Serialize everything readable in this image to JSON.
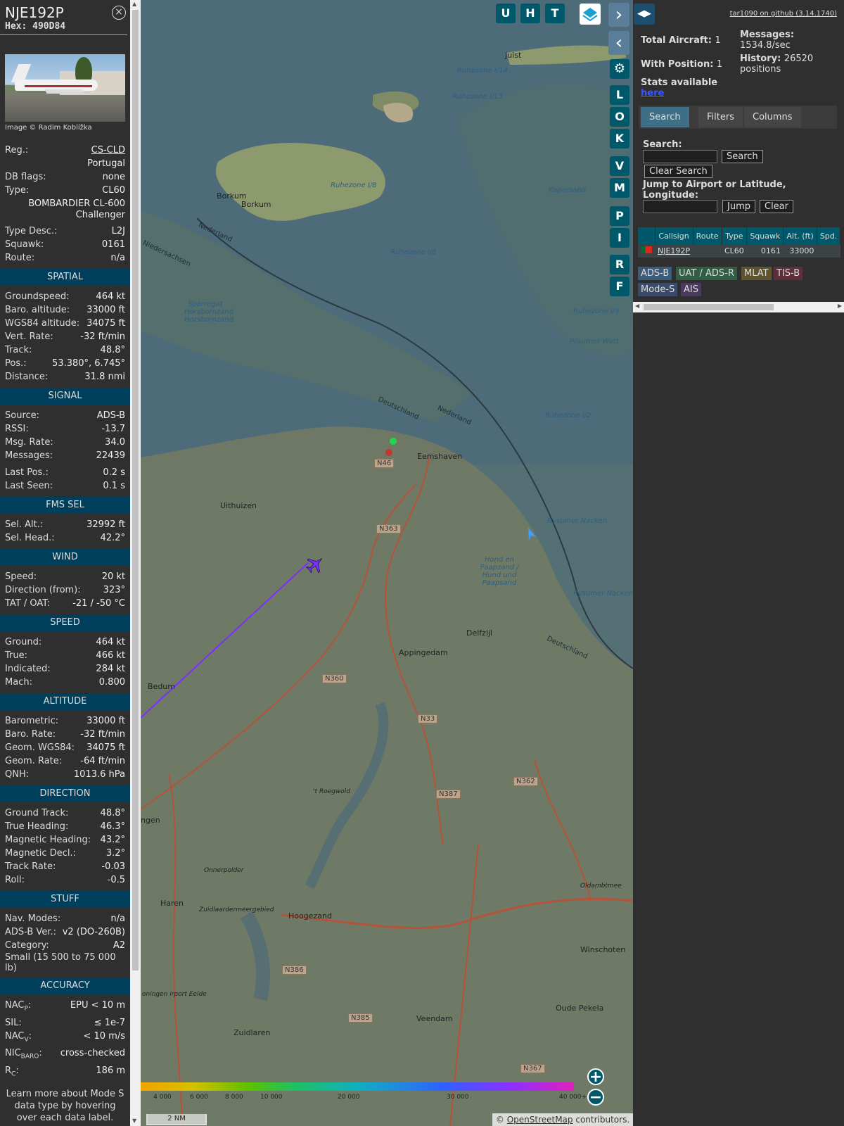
{
  "aircraft": {
    "callsign": "NJE192P",
    "hex": "Hex: 490D84",
    "photo_credit": "Image © Radim Koblížka",
    "close_icon": "×",
    "reg_label": "Reg.:",
    "reg_value": "CS-CLD",
    "country": "Portugal",
    "dbflags_label": "DB flags:",
    "dbflags_value": "none",
    "type_label": "Type:",
    "type_value": "CL60",
    "type_full": "BOMBARDIER CL-600 Challenger",
    "typedesc_label": "Type Desc.:",
    "typedesc_value": "L2J",
    "squawk_label": "Squawk:",
    "squawk_value": "0161",
    "route_label": "Route:",
    "route_value": "n/a"
  },
  "sections": [
    {
      "title": "SPATIAL",
      "rows": [
        {
          "label": "Groundspeed:",
          "value": "464 kt"
        },
        {
          "label": "Baro. altitude:",
          "value": "33000 ft"
        },
        {
          "label": "WGS84 altitude:",
          "value": "34075 ft"
        },
        {
          "label": "Vert. Rate:",
          "value": "-32 ft/min"
        },
        {
          "label": "Track:",
          "value": "48.8°"
        },
        {
          "label": "Pos.:",
          "value": "53.380°, 6.745°"
        },
        {
          "label": "Distance:",
          "value": "31.8 nmi"
        }
      ]
    },
    {
      "title": "SIGNAL",
      "rows": [
        {
          "label": "Source:",
          "value": "ADS-B"
        },
        {
          "label": "RSSI:",
          "value": "-13.7"
        },
        {
          "label": "Msg. Rate:",
          "value": "34.0"
        },
        {
          "label": "Messages:",
          "value": "22439"
        },
        {
          "label": "Last Pos.:",
          "value": "0.2 s"
        },
        {
          "label": "Last Seen:",
          "value": "0.1 s"
        }
      ]
    },
    {
      "title": "FMS SEL",
      "rows": [
        {
          "label": "Sel. Alt.:",
          "value": "32992 ft"
        },
        {
          "label": "Sel. Head.:",
          "value": "42.2°"
        }
      ]
    },
    {
      "title": "WIND",
      "rows": [
        {
          "label": "Speed:",
          "value": "20 kt"
        },
        {
          "label": "Direction (from):",
          "value": "323°"
        },
        {
          "label": "TAT / OAT:",
          "value": "-21 / -50 °C"
        }
      ]
    },
    {
      "title": "SPEED",
      "rows": [
        {
          "label": "Ground:",
          "value": "464 kt"
        },
        {
          "label": "True:",
          "value": "466 kt"
        },
        {
          "label": "Indicated:",
          "value": "284 kt"
        },
        {
          "label": "Mach:",
          "value": "0.800"
        }
      ]
    },
    {
      "title": "ALTITUDE",
      "rows": [
        {
          "label": "Barometric:",
          "value": "33000 ft"
        },
        {
          "label": "Baro. Rate:",
          "value": "-32 ft/min"
        },
        {
          "label": "Geom. WGS84:",
          "value": "34075 ft"
        },
        {
          "label": "Geom. Rate:",
          "value": "-64 ft/min"
        },
        {
          "label": "QNH:",
          "value": "1013.6 hPa"
        }
      ]
    },
    {
      "title": "DIRECTION",
      "rows": [
        {
          "label": "Ground Track:",
          "value": "48.8°"
        },
        {
          "label": "True Heading:",
          "value": "46.3°"
        },
        {
          "label": "Magnetic Heading:",
          "value": "43.2°"
        },
        {
          "label": "Magnetic Decl.:",
          "value": "3.2°"
        },
        {
          "label": "Track Rate:",
          "value": "-0.03"
        },
        {
          "label": "Roll:",
          "value": "-0.5"
        }
      ]
    },
    {
      "title": "STUFF",
      "rows": [
        {
          "label": "Nav. Modes:",
          "value": "n/a"
        },
        {
          "label": "ADS-B Ver.:",
          "value": "v2 (DO-260B)"
        },
        {
          "label": "Category:",
          "value": "A2"
        }
      ],
      "note": "Small (15 500 to 75 000 lb)"
    },
    {
      "title": "ACCURACY",
      "rows": [
        {
          "label": "NAC",
          "sub": "P",
          "value": "EPU < 10 m"
        },
        {
          "label": "SIL:",
          "value": "≤ 1e-7"
        },
        {
          "label": "NAC",
          "sub": "V",
          "value": "< 10 m/s"
        },
        {
          "label": "NIC",
          "sub": "BARO",
          "value": "cross-checked"
        },
        {
          "label": "R",
          "sub": "C",
          "value": "186 m"
        }
      ]
    }
  ],
  "learn_more": "Learn more about Mode S data type by hovering over each data label.",
  "map": {
    "buttons_top": [
      "U",
      "H",
      "T"
    ],
    "buttons_side": [
      "L",
      "O",
      "K",
      "V",
      "M",
      "P",
      "I",
      "R",
      "F"
    ],
    "scale": "2 NM",
    "attribution_prefix": "© ",
    "attribution_link": "OpenStreetMap",
    "attribution_suffix": " contributors.",
    "altitude_legend": [
      "4 000",
      "6 000",
      "8 000",
      "10 000",
      "20 000",
      "30 000",
      "40 000+"
    ],
    "places": [
      {
        "name": "Borkum",
        "kind": "town"
      },
      {
        "name": "Borkum",
        "kind": "town"
      },
      {
        "name": "Juist",
        "kind": "town"
      },
      {
        "name": "Uithuizen",
        "kind": "town"
      },
      {
        "name": "Eemshaven",
        "kind": "town"
      },
      {
        "name": "Delfzijl",
        "kind": "town"
      },
      {
        "name": "Appingedam",
        "kind": "town"
      },
      {
        "name": "Bedum",
        "kind": "town"
      },
      {
        "name": "Haren",
        "kind": "town"
      },
      {
        "name": "Hoogezand",
        "kind": "town"
      },
      {
        "name": "Winschoten",
        "kind": "town"
      },
      {
        "name": "Oude Pekela",
        "kind": "town"
      },
      {
        "name": "Veendam",
        "kind": "town"
      },
      {
        "name": "Zuidlaren",
        "kind": "town"
      },
      {
        "name": "ngen",
        "kind": "town"
      },
      {
        "name": "Ruhezone I/6",
        "kind": "sea"
      },
      {
        "name": "Ruhezone I/13",
        "kind": "sea"
      },
      {
        "name": "Ruhezone I/14",
        "kind": "sea"
      },
      {
        "name": "Ruhezone I/8",
        "kind": "sea"
      },
      {
        "name": "Ruhezone I/3",
        "kind": "sea"
      },
      {
        "name": "Ruhezone I/2",
        "kind": "sea"
      },
      {
        "name": "Hond en Paapzand / Hund und Paapsand",
        "kind": "sea"
      },
      {
        "name": "Rysumer Nacken",
        "kind": "sea"
      },
      {
        "name": "Rysumer Nacken",
        "kind": "sea"
      },
      {
        "name": "Pilsumer Watt",
        "kind": "sea"
      },
      {
        "name": "Kopersand",
        "kind": "sea"
      },
      {
        "name": "Sparregat Horsbornzand Horsbornzand",
        "kind": "sea"
      },
      {
        "name": "Nederland",
        "kind": "border"
      },
      {
        "name": "Niedersachsen",
        "kind": "border"
      },
      {
        "name": "Deutschland",
        "kind": "border"
      },
      {
        "name": "Nederland",
        "kind": "border"
      },
      {
        "name": "Deutschland",
        "kind": "border"
      },
      {
        "name": "'t Roegwold",
        "kind": "area"
      },
      {
        "name": "Onnerpolder",
        "kind": "area"
      },
      {
        "name": "Zuidlaardermeergebied",
        "kind": "area"
      },
      {
        "name": "Oldambtmee",
        "kind": "area"
      },
      {
        "name": "oningen irport Eelde",
        "kind": "area"
      }
    ],
    "roads": [
      "N46",
      "N363",
      "N360",
      "N33",
      "N362",
      "N387",
      "N386",
      "N385",
      "N367"
    ],
    "colors": {
      "water": "#4b6b7a",
      "land": "#6e7864",
      "track": "#7a30ff",
      "aircraft": "#7a30ff"
    }
  },
  "sidebar": {
    "github": "tar1090 on github (3.14.1740)",
    "total_aircraft_label": "Total Aircraft:",
    "total_aircraft": "1",
    "with_position_label": "With Position:",
    "with_position": "1",
    "messages_label": "Messages:",
    "messages_value": "1534.8/sec",
    "history_label": "History:",
    "history_value": "26520 positions",
    "stats_label": "Stats available",
    "stats_link": "here",
    "tabs": [
      "Search",
      "Filters",
      "Columns"
    ],
    "search_label": "Search:",
    "search_button": "Search",
    "clear_search_button": "Clear Search",
    "jump_label": "Jump to Airport or Latitude, Longitude:",
    "jump_button": "Jump",
    "clear_button": "Clear",
    "table_headers": [
      "",
      "Callsign",
      "Route",
      "Type",
      "Squawk",
      "Alt. (ft)",
      "Spd."
    ],
    "table_rows": [
      {
        "callsign": "NJE192P",
        "route": "",
        "type": "CL60",
        "squawk": "0161",
        "alt": "33000"
      }
    ],
    "source_badges": [
      {
        "label": "ADS-B",
        "color": "#3a5b7a"
      },
      {
        "label": "UAT / ADS-R",
        "color": "#2f5e43"
      },
      {
        "label": "MLAT",
        "color": "#5e5430"
      },
      {
        "label": "TIS-B",
        "color": "#5e2f3a"
      },
      {
        "label": "Mode-S",
        "color": "#3a4a6a"
      },
      {
        "label": "AIS",
        "color": "#4b3a5e"
      }
    ]
  }
}
